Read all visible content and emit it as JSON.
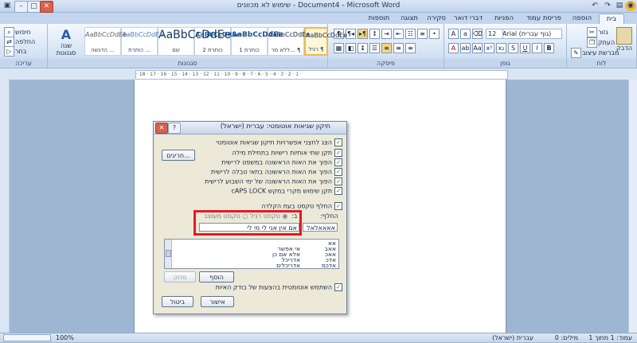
{
  "window": {
    "title": "שימוש לא מכוונים - Document4 - Microsoft Word",
    "minimize": "–",
    "maximize": "□",
    "close": "✕"
  },
  "tabs": [
    "בית",
    "הוספה",
    "פריסת עמוד",
    "הפניות",
    "דברי דואר",
    "סקירה",
    "תצוגה",
    "תוספות"
  ],
  "ribbon": {
    "clipboard": {
      "label": "לוח",
      "paste": "הדבק",
      "cut": "גזור",
      "copy": "העתק",
      "format_painter": "מברשת עיצוב"
    },
    "font": {
      "label": "גופן",
      "font_name": "Arial (גוף עברית)",
      "font_size": "12"
    },
    "paragraph": {
      "label": "פיסקה"
    },
    "styles": {
      "label": "סגנונות",
      "tiles": [
        {
          "sample": "AaBbCcDdEe",
          "name": "רגיל ¶"
        },
        {
          "sample": "AaBbCcDdEe",
          "name": "ללא מר... ¶"
        },
        {
          "sample": "AaBbCcDdEe",
          "name": "כותרת 1"
        },
        {
          "sample": "AaBbCcDdEe",
          "name": "כותרת 2"
        },
        {
          "sample": "AaBbCcDdEe",
          "name": "שם"
        },
        {
          "sample": "AaBbCcDdEe",
          "name": "כותרת ..."
        },
        {
          "sample": "AaBbCcDdEe",
          "name": "הדגשה ..."
        }
      ],
      "change_styles": "שנה סגנונות"
    },
    "editing": {
      "label": "עריכה",
      "find": "חיפוש",
      "replace": "החלפה",
      "select": "בחר"
    }
  },
  "ruler_text": "· 18 · 17 · 16 · 15 · 14 · 13 · 12 · 11 · 10 · 9 · 8 · 7 · 6 · 5 · 4 · 3 · 2 · 1 ·",
  "dialog": {
    "title": "תיקון שגיאות אוטומטי: עברית (ישראל)",
    "help": "?",
    "close": "✕",
    "options": [
      "הצג לחצני אפשרויות תיקון שגיאות אוטומטי",
      "תקן שתי אותיות רישיות בתחילת מילה",
      "הפוך את האות הראשונה במשפט לרישית",
      "הפוך את האות הראשונה בתאי טבלה לרישית",
      "הפוך את האות הראשונה של ימי השבוע לרישית",
      "תקן שימוש מקרי במקש cAPS LOCK"
    ],
    "exceptions_button": "חריגים...",
    "replace_as_you_type": "החלף טקסט בעת הקלדה",
    "replace_label": "החלף:",
    "with_label": "ב:",
    "plain_text": "טקסט רגיל",
    "formatted_text": "טקסט מעוצב",
    "replace_value": "אאאאלאל",
    "with_value": "אם אין אני לי מי לי",
    "list": [
      {
        "from": "אא",
        "to": ""
      },
      {
        "from": "אאב",
        "to": "אי אפשר"
      },
      {
        "from": "אאכ",
        "to": "אלא אם כן"
      },
      {
        "from": "אדכ",
        "to": "אדריכל"
      },
      {
        "from": "אדכמ",
        "to": "אדריכלים"
      }
    ],
    "add_button": "הוסף",
    "delete_button": "מחק",
    "use_suggestions": "השתמש אוטומטית בהצעות של בודק האיות",
    "ok_button": "אישור",
    "cancel_button": "ביטול"
  },
  "status": {
    "page": "עמוד: 1 מתוך 1",
    "words": "מילים: 0",
    "language": "עברית (ישראל)",
    "zoom": "100%"
  }
}
